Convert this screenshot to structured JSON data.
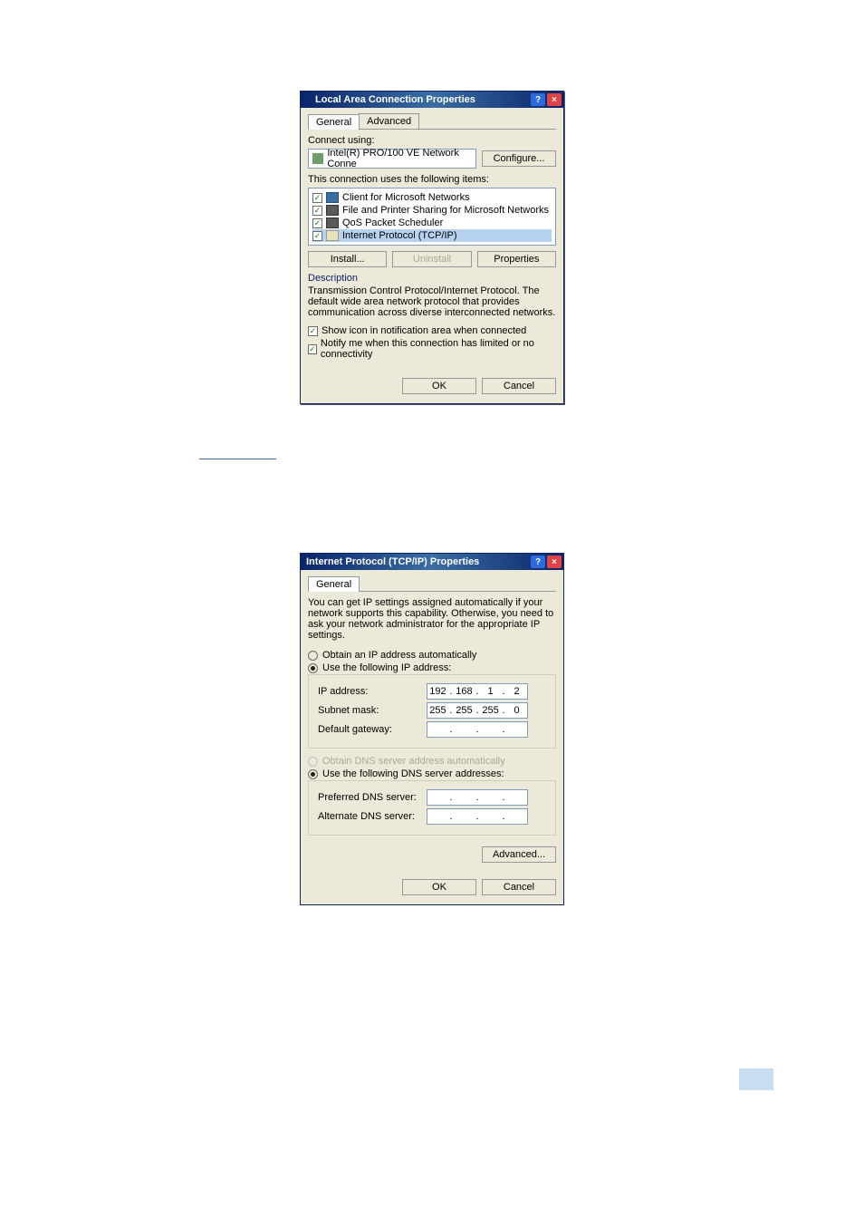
{
  "dialog1": {
    "title": "Local Area Connection Properties",
    "tabs": {
      "general": "General",
      "advanced": "Advanced"
    },
    "connect_using_label": "Connect using:",
    "adapter_name": "Intel(R) PRO/100 VE Network Conne",
    "configure_btn": "Configure...",
    "items_label": "This connection uses the following items:",
    "items": [
      {
        "label": "Client for Microsoft Networks",
        "icon": "client"
      },
      {
        "label": "File and Printer Sharing for Microsoft Networks",
        "icon": "service"
      },
      {
        "label": "QoS Packet Scheduler",
        "icon": "service"
      },
      {
        "label": "Internet Protocol (TCP/IP)",
        "icon": "tcp",
        "selected": true
      }
    ],
    "install_btn": "Install...",
    "uninstall_btn": "Uninstall",
    "properties_btn": "Properties",
    "desc_heading": "Description",
    "desc_text": "Transmission Control Protocol/Internet Protocol. The default wide area network protocol that provides communication across diverse interconnected networks.",
    "show_icon_label": "Show icon in notification area when connected",
    "notify_label": "Notify me when this connection has limited or no connectivity",
    "ok_btn": "OK",
    "cancel_btn": "Cancel"
  },
  "dialog2": {
    "title": "Internet Protocol (TCP/IP) Properties",
    "tab_general": "General",
    "info": "You can get IP settings assigned automatically if your network supports this capability. Otherwise, you need to ask your network administrator for the appropriate IP settings.",
    "obtain_ip": "Obtain an IP address automatically",
    "use_ip": "Use the following IP address:",
    "ip_address_label": "IP address:",
    "ip_address": [
      "192",
      "168",
      "1",
      "2"
    ],
    "subnet_label": "Subnet mask:",
    "subnet": [
      "255",
      "255",
      "255",
      "0"
    ],
    "gateway_label": "Default gateway:",
    "gateway": [
      "",
      "",
      "",
      ""
    ],
    "obtain_dns": "Obtain DNS server address automatically",
    "use_dns": "Use the following DNS server addresses:",
    "pref_dns_label": "Preferred DNS server:",
    "pref_dns": [
      "",
      "",
      "",
      ""
    ],
    "alt_dns_label": "Alternate DNS server:",
    "alt_dns": [
      "",
      "",
      "",
      ""
    ],
    "advanced_btn": "Advanced...",
    "ok_btn": "OK",
    "cancel_btn": "Cancel"
  }
}
